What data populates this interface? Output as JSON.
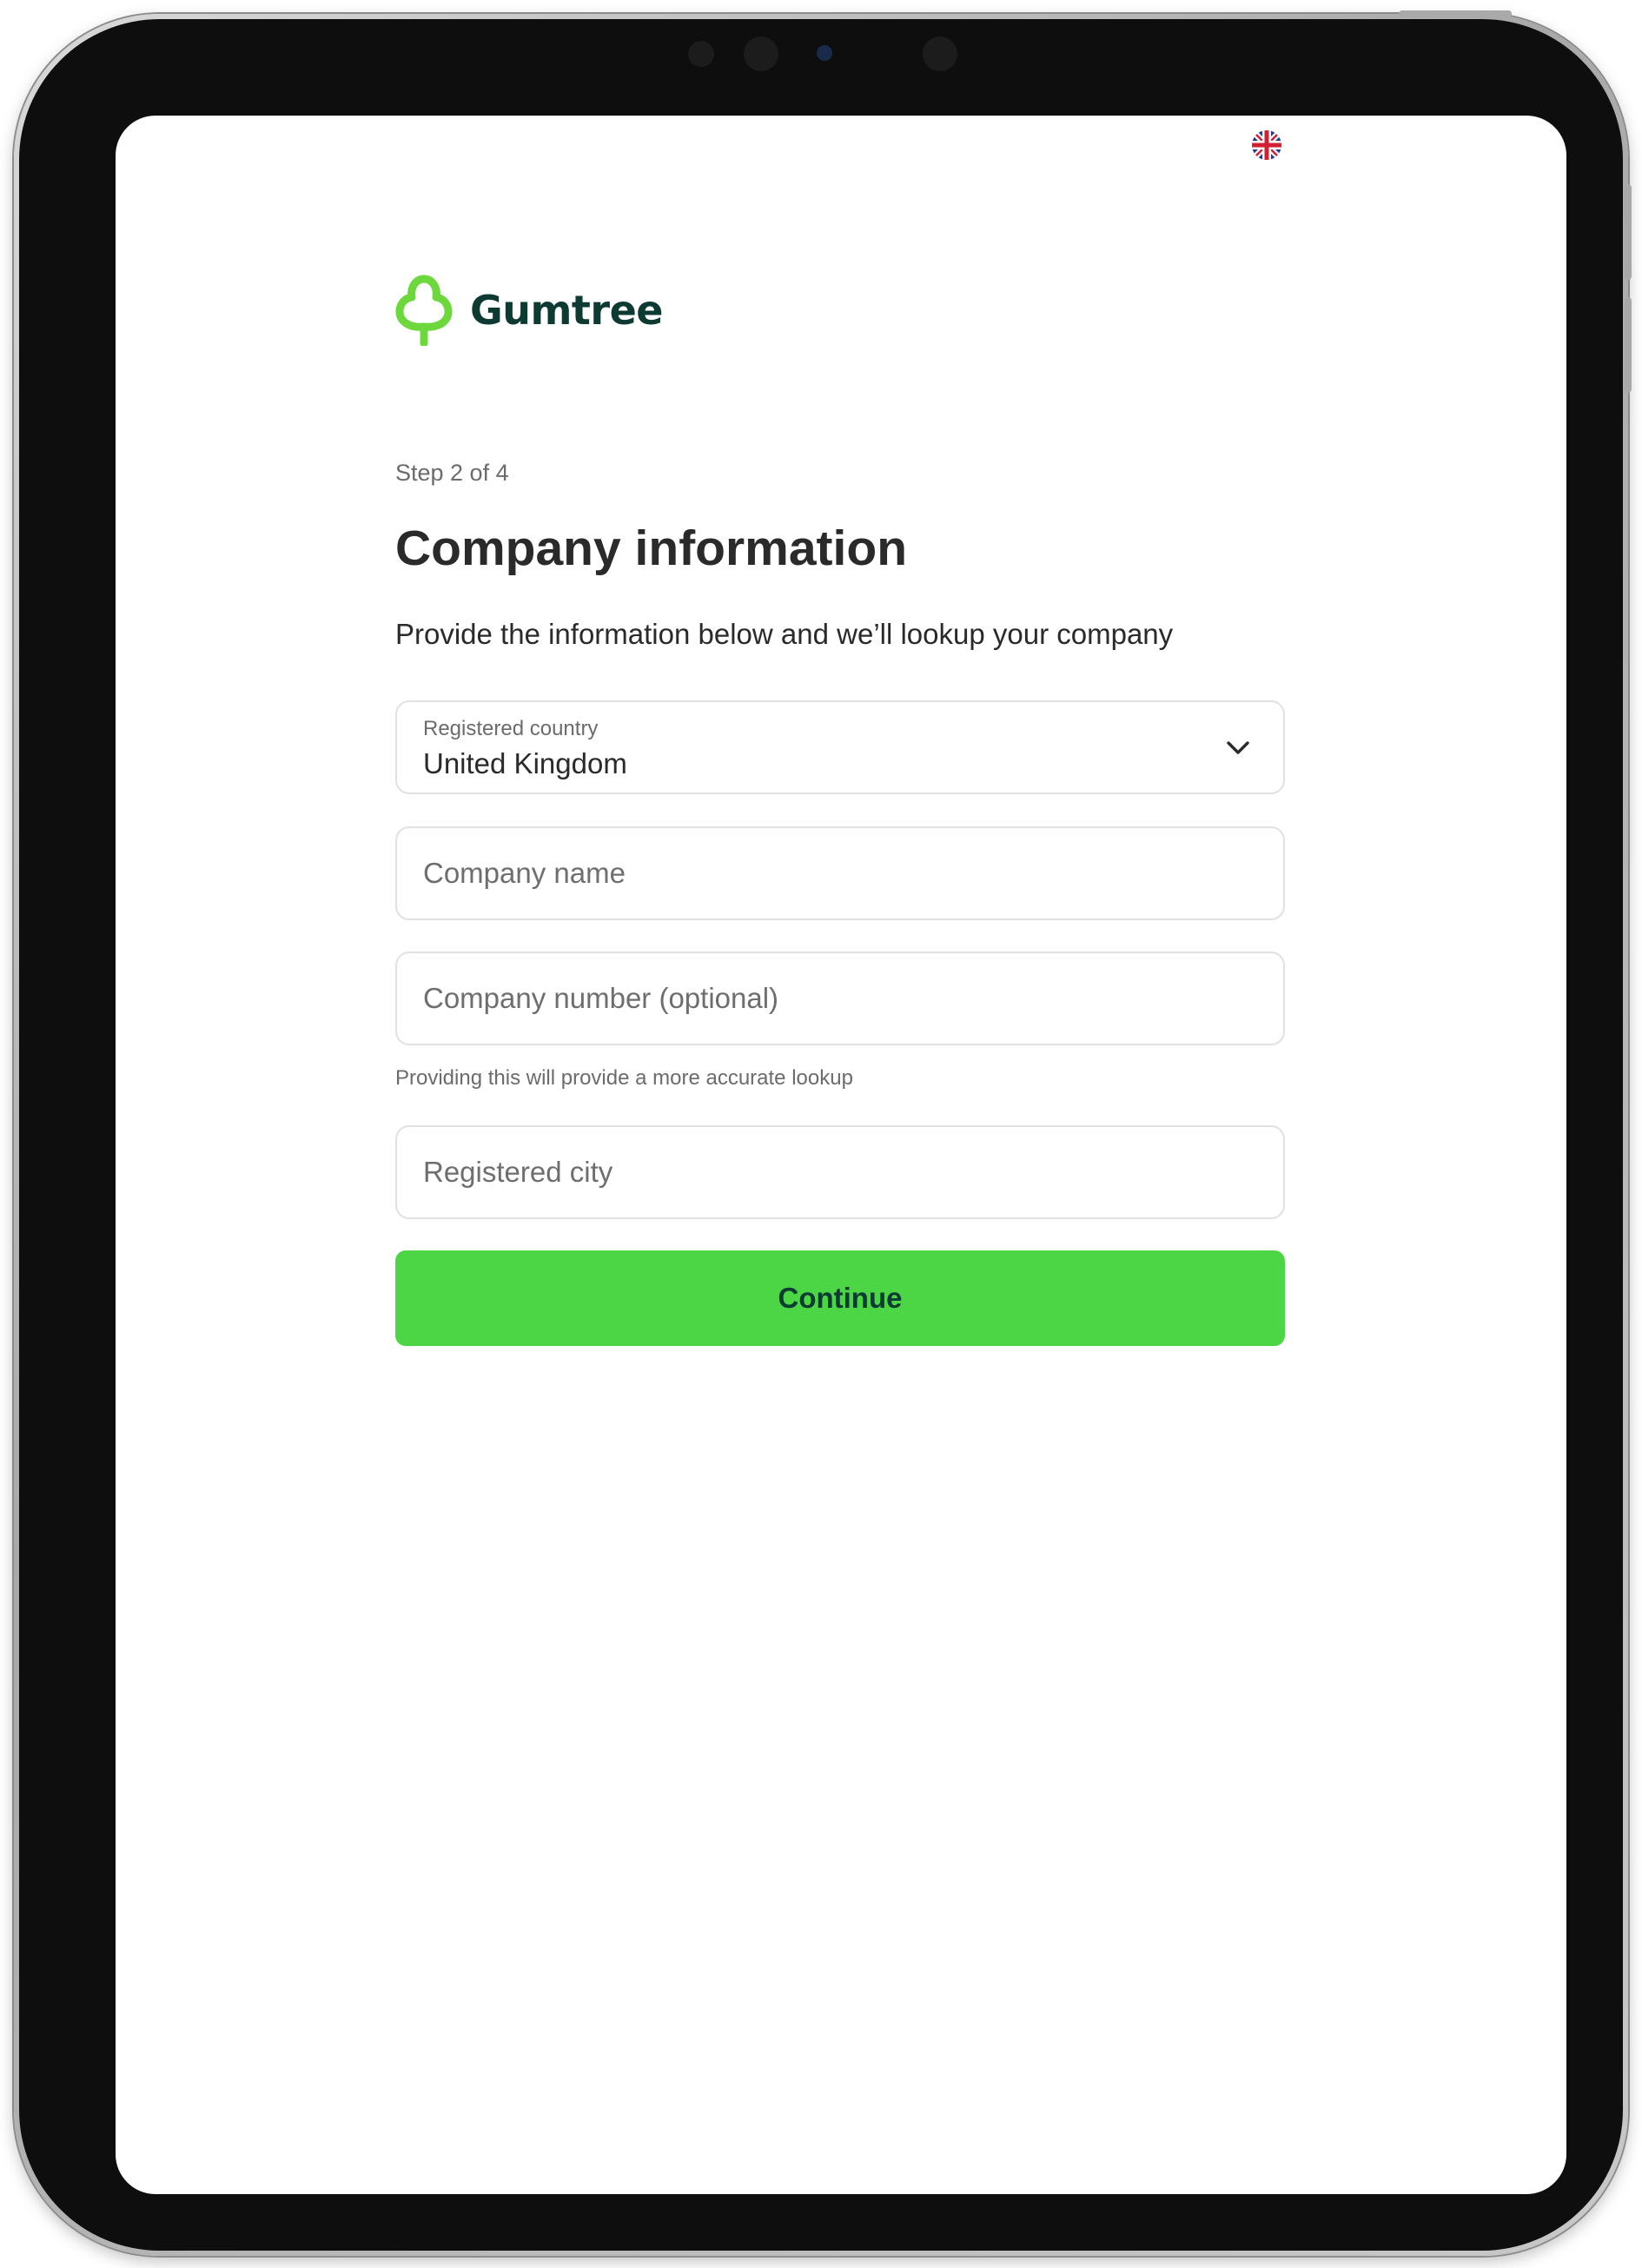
{
  "lang": {
    "flag_icon": "uk-flag-icon"
  },
  "brand": {
    "name": "Gumtree",
    "icon": "tree-logo-icon",
    "color": "#6cd83b",
    "text_color": "#0d3a32"
  },
  "form": {
    "step": "Step 2 of 4",
    "title": "Company information",
    "subtitle": "Provide the information below and we’ll lookup your company",
    "country": {
      "label": "Registered country",
      "value": "United Kingdom",
      "icon": "chevron-down-icon"
    },
    "company_name": {
      "placeholder": "Company name",
      "value": ""
    },
    "company_number": {
      "placeholder": "Company number (optional)",
      "value": "",
      "helper": "Providing this will provide a more accurate lookup"
    },
    "city": {
      "placeholder": "Registered city",
      "value": ""
    },
    "continue_label": "Continue"
  },
  "colors": {
    "accent": "#4cd645",
    "text": "#2a2a2a",
    "muted": "#6b6b6b",
    "border": "#e1e1e1"
  }
}
